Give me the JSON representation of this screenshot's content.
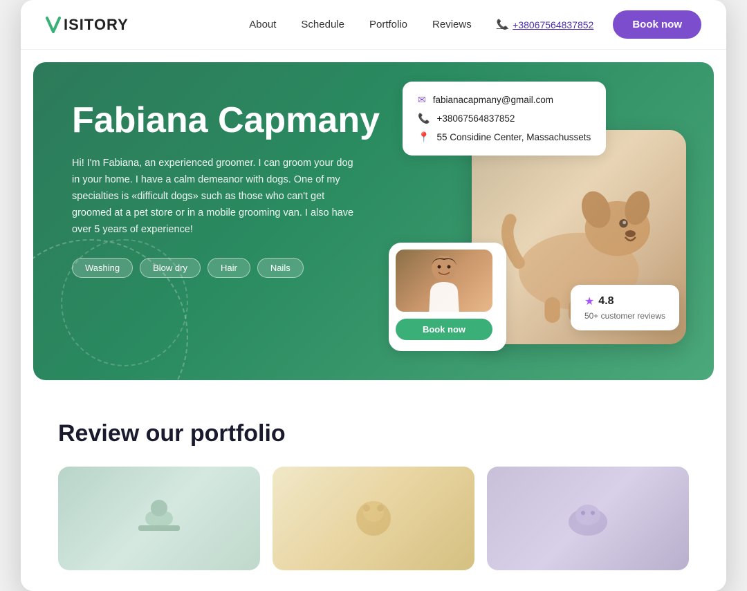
{
  "brand": {
    "name": "ISITORY",
    "logo_letter": "V"
  },
  "nav": {
    "links": [
      {
        "label": "About",
        "href": "#"
      },
      {
        "label": "Schedule",
        "href": "#"
      },
      {
        "label": "Portfolio",
        "href": "#"
      },
      {
        "label": "Reviews",
        "href": "#"
      }
    ],
    "phone": "+38067564837852",
    "book_label": "Book now"
  },
  "hero": {
    "name": "Fabiana Capmany",
    "description": "Hi! I'm Fabiana, an experienced groomer. I can groom your dog in your home. I have a calm demeanor with dogs. One of my specialties is «difficult dogs» such as those who can't get groomed at a pet store or in a mobile grooming van. I also have over 5 years of experience!",
    "tags": [
      "Washing",
      "Blow dry",
      "Hair",
      "Nails"
    ],
    "contact": {
      "email": "fabianacapmany@gmail.com",
      "phone": "+38067564837852",
      "address": "55 Considine Center, Massachussets"
    },
    "rating": {
      "score": "4.8",
      "reviews": "50+ customer reviews"
    },
    "book_label": "Book now"
  },
  "portfolio": {
    "title": "Review our portfolio",
    "thumbs": [
      {
        "alt": "Portfolio photo 1"
      },
      {
        "alt": "Portfolio photo 2"
      },
      {
        "alt": "Portfolio photo 3"
      }
    ]
  }
}
